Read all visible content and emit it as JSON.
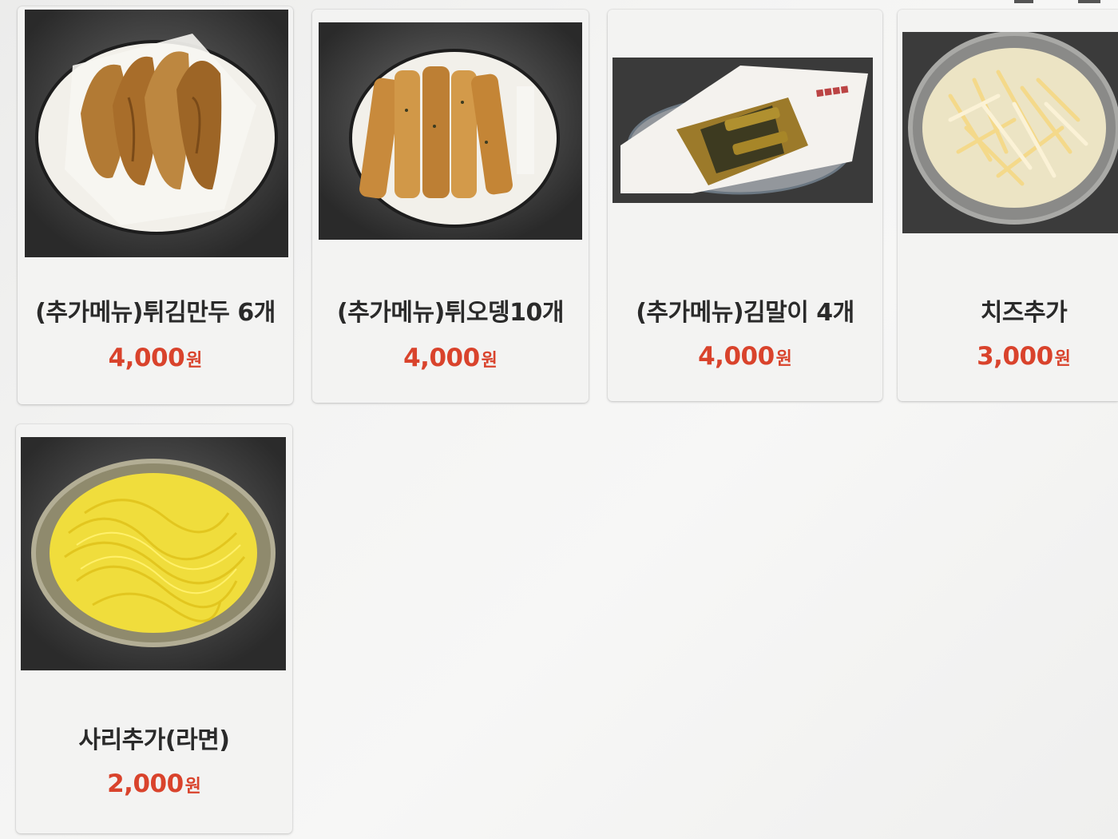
{
  "colors": {
    "price": "#d9432c",
    "name": "#2a2a2a",
    "card": "#f3f3f2"
  },
  "menu": {
    "items": [
      {
        "name": "(추가메뉴)튀김만두 6개",
        "price": "4,000",
        "currency": "원",
        "image": "fried-dumplings-photo"
      },
      {
        "name": "(추가메뉴)튀오뎅10개",
        "price": "4,000",
        "currency": "원",
        "image": "fried-fishcake-photo"
      },
      {
        "name": "(추가메뉴)김말이 4개",
        "price": "4,000",
        "currency": "원",
        "image": "seaweed-rolls-photo"
      },
      {
        "name": "치즈추가",
        "price": "3,000",
        "currency": "원",
        "image": "shredded-cheese-photo"
      },
      {
        "name": "사리추가(라면)",
        "price": "2,000",
        "currency": "원",
        "image": "ramen-noodles-photo"
      }
    ]
  }
}
